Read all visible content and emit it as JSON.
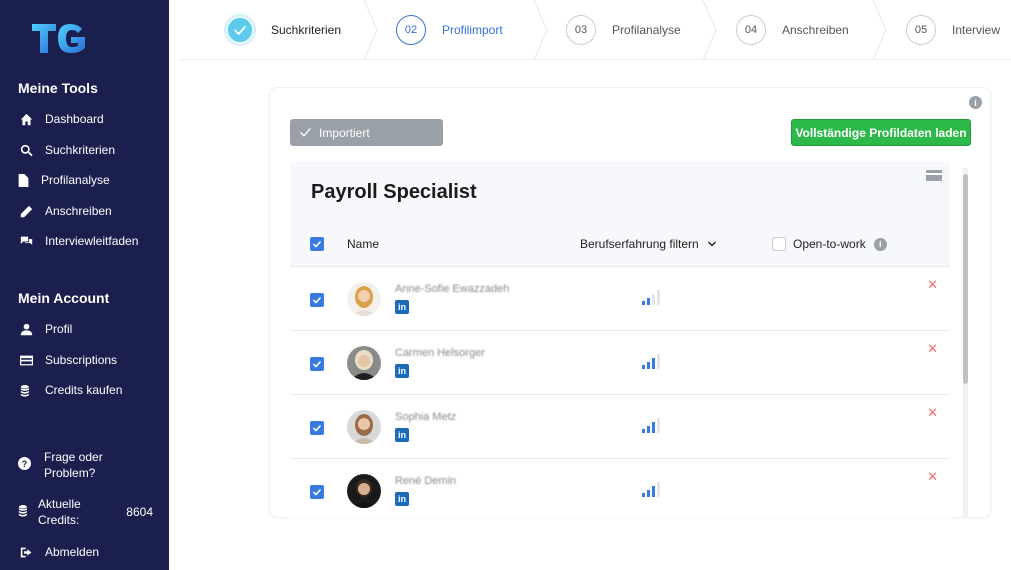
{
  "sidebar": {
    "logo": "TG",
    "tools_title": "Meine Tools",
    "tools": [
      {
        "label": "Dashboard",
        "icon": "home-icon"
      },
      {
        "label": "Suchkriterien",
        "icon": "search-icon"
      },
      {
        "label": "Profilanalyse",
        "icon": "file-icon"
      },
      {
        "label": "Anschreiben",
        "icon": "pencil-icon"
      },
      {
        "label": "Interviewleitfaden",
        "icon": "chat-icon"
      }
    ],
    "account_title": "Mein Account",
    "account": [
      {
        "label": "Profil",
        "icon": "user-icon"
      },
      {
        "label": "Subscriptions",
        "icon": "credit-card-icon"
      },
      {
        "label": "Credits kaufen",
        "icon": "coins-icon"
      }
    ],
    "help_line1": "Frage oder",
    "help_line2": "Problem?",
    "credits_line1": "Aktuelle",
    "credits_line2": "Credits:",
    "credits_value": "8604",
    "logout": "Abmelden"
  },
  "stepper": {
    "steps": [
      {
        "number": "",
        "label": "Suchkriterien",
        "state": "done"
      },
      {
        "number": "02",
        "label": "Profilimport",
        "state": "active"
      },
      {
        "number": "03",
        "label": "Profilanalyse",
        "state": "pending"
      },
      {
        "number": "04",
        "label": "Anschreiben",
        "state": "pending"
      },
      {
        "number": "05",
        "label": "Interview",
        "state": "pending"
      }
    ]
  },
  "card": {
    "imported_label": "Importiert",
    "load_button": "Vollständige Profildaten laden",
    "job_title": "Payroll Specialist",
    "columns": {
      "name": "Name",
      "experience": "Berufserfahrung filtern",
      "open_to_work": "Open-to-work"
    },
    "rows": [
      {
        "name": "Anne-Sofie Ewazzadeh",
        "experience_level": 2
      },
      {
        "name": "Carmen Helsorger",
        "experience_level": 3
      },
      {
        "name": "Sophia Metz",
        "experience_level": 3
      },
      {
        "name": "René Demin",
        "experience_level": 3
      }
    ]
  },
  "colors": {
    "sidebar_bg": "#1a1f4e",
    "accent_blue": "#3b7ae0",
    "green_button": "#2cb94a",
    "remove_red": "#ee6b6b"
  }
}
